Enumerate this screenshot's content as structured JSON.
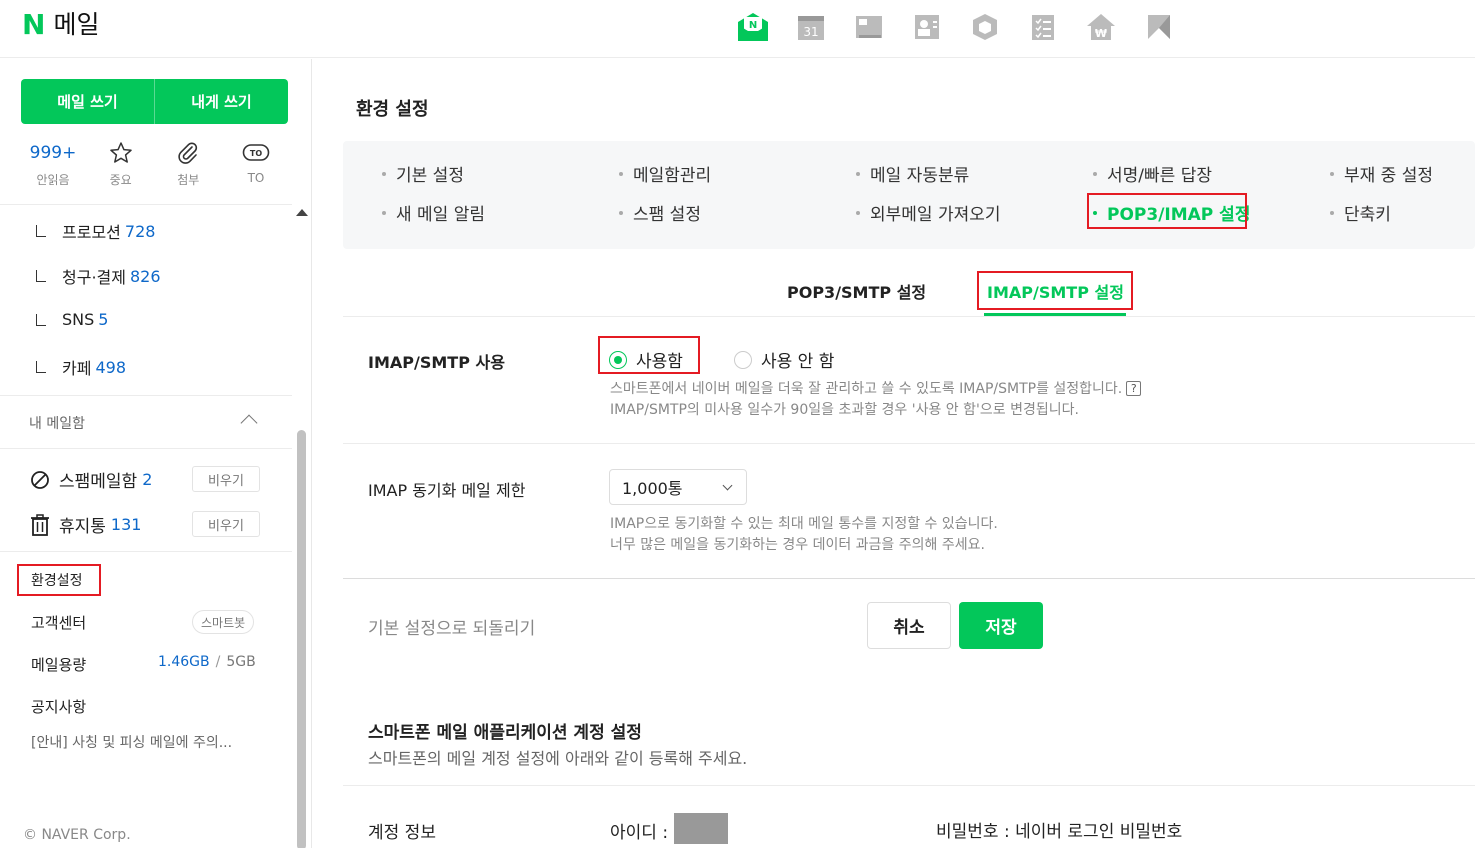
{
  "header": {
    "logo_letter": "N",
    "logo_text": "메일",
    "calendar_day": "31",
    "mail_icon_letter": "N",
    "apps": [
      "mail-icon",
      "calendar-icon",
      "note-icon",
      "contacts-icon",
      "mybox-icon",
      "todo-icon",
      "household-icon",
      "office-icon"
    ]
  },
  "sidebar": {
    "compose": {
      "write": "메일 쓰기",
      "write_self": "내게 쓰기"
    },
    "quick": [
      {
        "count": "999+",
        "label": "안읽음"
      },
      {
        "label": "중요"
      },
      {
        "label": "첨부"
      },
      {
        "badge": "TO",
        "label": "TO"
      }
    ],
    "folders": [
      {
        "name": "프로모션",
        "count": "728"
      },
      {
        "name": "청구·결제",
        "count": "826"
      },
      {
        "name": "SNS",
        "count": "5"
      },
      {
        "name": "카페",
        "count": "498"
      }
    ],
    "mymail_label": "내 메일함",
    "spam": {
      "name": "스팸메일함",
      "count": "2",
      "empty": "비우기"
    },
    "trash": {
      "name": "휴지통",
      "count": "131",
      "empty": "비우기"
    },
    "settings": "환경설정",
    "support": "고객센터",
    "smartbot": "스마트봇",
    "storage_label": "메일용량",
    "storage_used": "1.46GB",
    "storage_sep": "/",
    "storage_total": "5GB",
    "notice": "공지사항",
    "notice_text": "[안내] 사칭 및 피싱 메일에 주의...",
    "copyright": "© NAVER Corp."
  },
  "main": {
    "title": "환경 설정",
    "tabs_row1": [
      "기본 설정",
      "메일함관리",
      "메일 자동분류",
      "서명/빠른 답장",
      "부재 중 설정"
    ],
    "tabs_row2": [
      "새 메일 알림",
      "스팸 설정",
      "외부메일 가져오기",
      "POP3/IMAP 설정",
      "단축키"
    ],
    "subtabs": [
      "POP3/SMTP 설정",
      "IMAP/SMTP 설정"
    ],
    "imap_use_label": "IMAP/SMTP 사용",
    "radio_on": "사용함",
    "radio_off": "사용 안 함",
    "imap_help1": "스마트폰에서 네이버 메일을 더욱 잘 관리하고 쓸 수 있도록 IMAP/SMTP를 설정합니다.",
    "imap_help_q": "?",
    "imap_help2": "IMAP/SMTP의 미사용 일수가 90일을 초과할 경우 '사용 안 함'으로 변경됩니다.",
    "sync_label": "IMAP 동기화 메일 제한",
    "sync_value": "1,000통",
    "sync_help1": "IMAP으로 동기화할 수 있는 최대 메일 통수를 지정할 수 있습니다.",
    "sync_help2": "너무 많은 메일을 동기화하는 경우 데이터 과금을 주의해 주세요.",
    "reset": "기본 설정으로 되돌리기",
    "cancel": "취소",
    "save": "저장",
    "section_title": "스마트폰 메일 애플리케이션 계정 설정",
    "section_desc": "스마트폰의 메일 계정 설정에 아래와 같이 등록해 주세요.",
    "account_label": "계정 정보",
    "account_id_label": "아이디 :",
    "account_pw": "비밀번호 : 네이버 로그인 비밀번호"
  },
  "colors": {
    "accent": "#03c75a",
    "link": "#0e68c9",
    "highlight": "#e41b23"
  }
}
